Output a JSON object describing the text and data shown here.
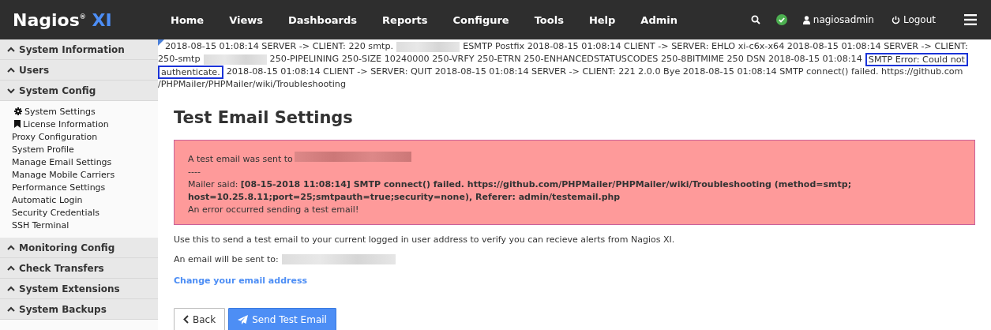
{
  "topbar": {
    "logo": {
      "name": "Nagios",
      "mark": "®",
      "suffix": "XI"
    },
    "nav": [
      {
        "label": "Home"
      },
      {
        "label": "Views"
      },
      {
        "label": "Dashboards"
      },
      {
        "label": "Reports"
      },
      {
        "label": "Configure"
      },
      {
        "label": "Tools"
      },
      {
        "label": "Help"
      },
      {
        "label": "Admin"
      }
    ],
    "user": "nagiosadmin",
    "logout": "Logout",
    "status_ok": true
  },
  "sidebar": [
    {
      "title": "System Information",
      "expanded": false
    },
    {
      "title": "Users",
      "expanded": false
    },
    {
      "title": "System Config",
      "expanded": true,
      "items": [
        {
          "label": "System Settings"
        },
        {
          "label": "License Information"
        },
        {
          "label": "Proxy Configuration"
        },
        {
          "label": "System Profile"
        },
        {
          "label": "Manage Email Settings"
        },
        {
          "label": "Manage Mobile Carriers"
        },
        {
          "label": "Performance Settings"
        },
        {
          "label": "Automatic Login"
        },
        {
          "label": "Security Credentials"
        },
        {
          "label": "SSH Terminal"
        }
      ]
    },
    {
      "title": "Monitoring Config",
      "expanded": false
    },
    {
      "title": "Check Transfers",
      "expanded": false
    },
    {
      "title": "System Extensions",
      "expanded": false
    },
    {
      "title": "System Backups",
      "expanded": false
    }
  ],
  "log": [
    [
      {
        "kind": "text",
        "text": "2018-08-15 01:08:14 SERVER -> CLIENT: 220 smtp."
      },
      {
        "kind": "redacted"
      },
      {
        "kind": "text",
        "text": "ESMTP Postfix 2018-08-15 01:08:14 CLIENT -> SERVER: EHLO xi-c6x-x64 2018-08-15 01:08:14 SERVER -> CLIENT:"
      }
    ],
    [
      {
        "kind": "text",
        "text": "250-smtp"
      },
      {
        "kind": "redacted"
      },
      {
        "kind": "text",
        "text": "250-PIPELINING 250-SIZE 10240000 250-VRFY 250-ETRN 250-ENHANCEDSTATUSCODES 250-8BITMIME 250 DSN 2018-08-15 01:08:14"
      },
      {
        "kind": "highlight",
        "text": "SMTP Error: Could not"
      }
    ],
    [
      {
        "kind": "highlight",
        "text": "authenticate."
      },
      {
        "kind": "text",
        "text": "2018-08-15 01:08:14 CLIENT -> SERVER: QUIT 2018-08-15 01:08:14 SERVER -> CLIENT: 221 2.0.0 Bye 2018-08-15 01:08:14 SMTP connect() failed. https://github.com"
      }
    ],
    [
      {
        "kind": "text",
        "text": "/PHPMailer/PHPMailer/wiki/Troubleshooting"
      }
    ]
  ],
  "page": {
    "title": "Test Email Settings",
    "alert": {
      "sent_to": "A test email was sent to",
      "separator": "----",
      "mailer_label": "Mailer said:",
      "mailer_message": "[08-15-2018 11:08:14] SMTP connect() failed. https://github.com/PHPMailer/PHPMailer/wiki/Troubleshooting (method=smtp; host=10.25.8.11;port=25;smtpauth=true;security=none), Referer: admin/testemail.php",
      "error": "An error occurred sending a test email!"
    },
    "description": "Use this to send a test email to your current logged in user address to verify you can recieve alerts from Nagios XI.",
    "will_send": "An email will be sent to:",
    "change_link": "Change your email address",
    "buttons": [
      {
        "label": "Back",
        "kind": "back"
      },
      {
        "label": "Send Test Email",
        "kind": "send"
      }
    ]
  }
}
